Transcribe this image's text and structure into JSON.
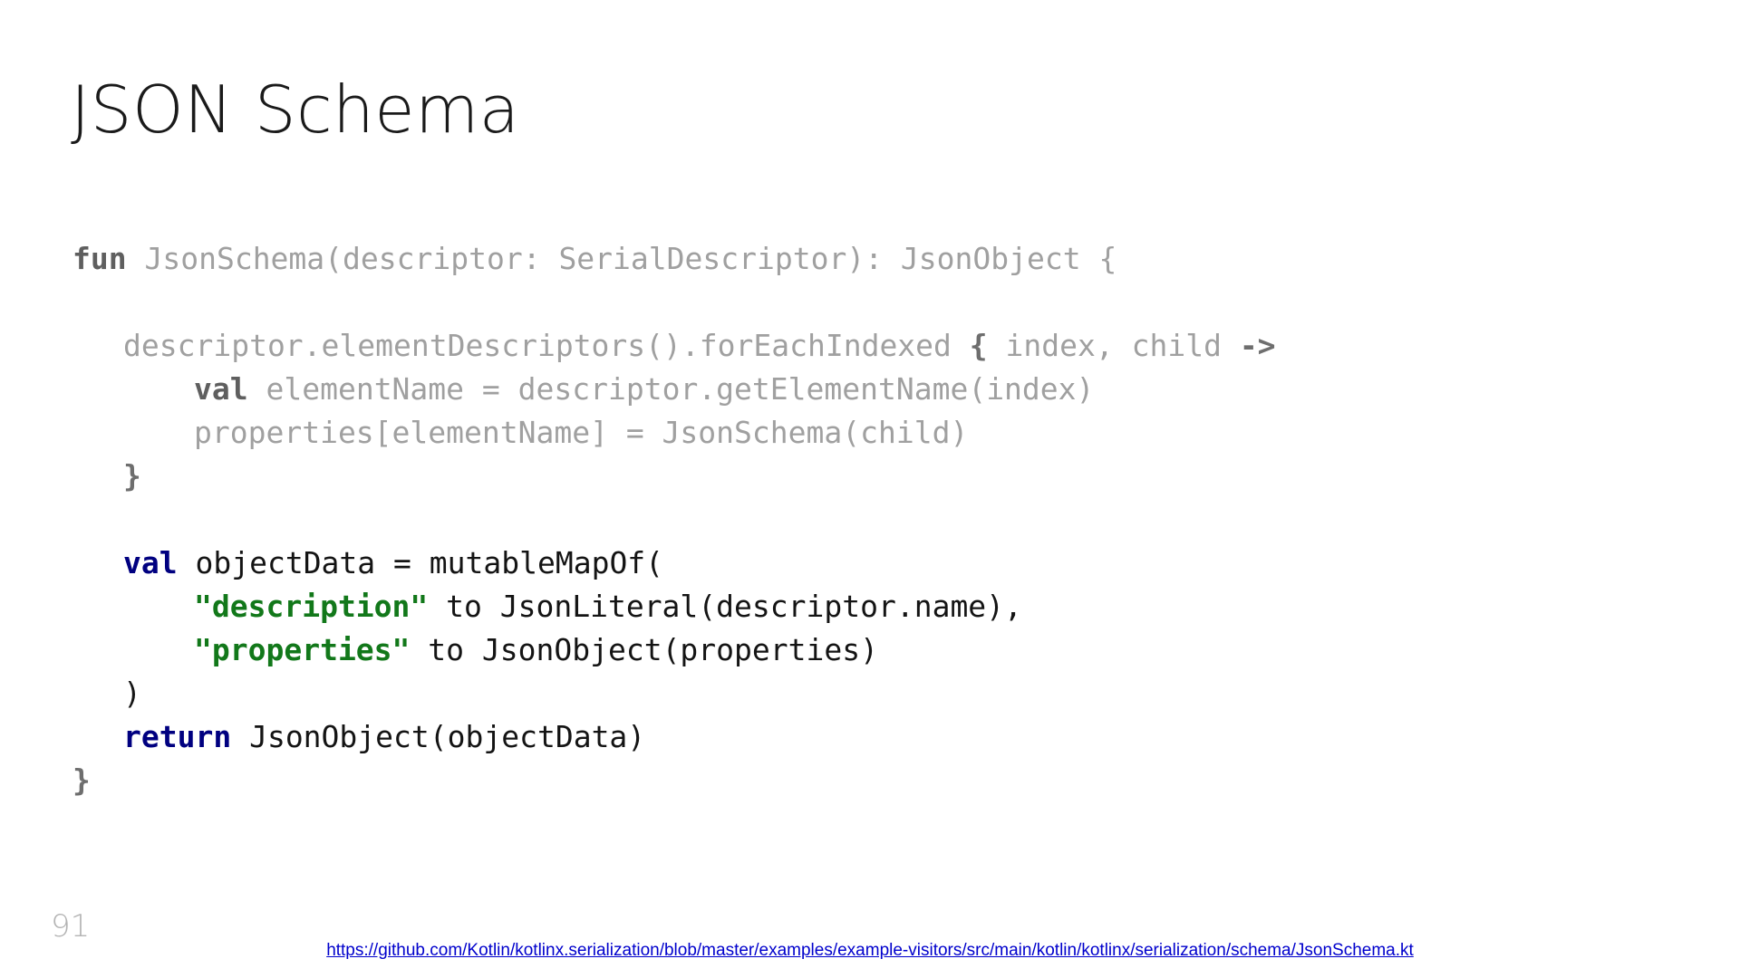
{
  "slide": {
    "title": "JSON Schema",
    "page_number": "91",
    "background_color": "#ffffff"
  },
  "colors": {
    "title_text": "#1a1a1a",
    "code_dim": "#a0a0a0",
    "code_keyword_dim": "#5f5f5f",
    "code_black": "#141414",
    "code_keyword_navy": "#000080",
    "code_string_green": "#12781a",
    "link_blue": "#0000cc",
    "page_number_gray": "#b3b3b3"
  },
  "code": {
    "language": "kotlin",
    "lines": [
      {
        "indent": 0,
        "tokens": [
          {
            "text": "fun ",
            "style": "keyword-dim"
          },
          {
            "text": "JsonSchema(descriptor: SerialDescriptor): JsonObject {",
            "style": "dim"
          }
        ]
      },
      {
        "indent": 0,
        "tokens": []
      },
      {
        "indent": 1,
        "tokens": [
          {
            "text": "descriptor.elementDescriptors().forEachIndexed ",
            "style": "dim"
          },
          {
            "text": "{",
            "style": "brace-dim"
          },
          {
            "text": " index, child ",
            "style": "dim"
          },
          {
            "text": "->",
            "style": "brace-dim"
          }
        ]
      },
      {
        "indent": 2,
        "tokens": [
          {
            "text": "val ",
            "style": "keyword-dim"
          },
          {
            "text": "elementName = descriptor.getElementName(index)",
            "style": "dim"
          }
        ]
      },
      {
        "indent": 2,
        "tokens": [
          {
            "text": "properties[elementName] = JsonSchema(child)",
            "style": "dim"
          }
        ]
      },
      {
        "indent": 1,
        "tokens": [
          {
            "text": "}",
            "style": "brace-dim"
          }
        ]
      },
      {
        "indent": 0,
        "tokens": []
      },
      {
        "indent": 1,
        "tokens": [
          {
            "text": "val ",
            "style": "navy"
          },
          {
            "text": "objectData = mutableMapOf(",
            "style": "black"
          }
        ]
      },
      {
        "indent": 2,
        "tokens": [
          {
            "text": "\"description\"",
            "style": "green"
          },
          {
            "text": " to JsonLiteral(descriptor.name),",
            "style": "black"
          }
        ]
      },
      {
        "indent": 2,
        "tokens": [
          {
            "text": "\"properties\"",
            "style": "green"
          },
          {
            "text": " to JsonObject(properties)",
            "style": "black"
          }
        ]
      },
      {
        "indent": 1,
        "tokens": [
          {
            "text": ")",
            "style": "black"
          }
        ]
      },
      {
        "indent": 1,
        "tokens": [
          {
            "text": "return ",
            "style": "navy"
          },
          {
            "text": "JsonObject(objectData)",
            "style": "black"
          }
        ]
      },
      {
        "indent": 0,
        "tokens": [
          {
            "text": "}",
            "style": "brace-dim"
          }
        ]
      }
    ],
    "plain_text": "fun JsonSchema(descriptor: SerialDescriptor): JsonObject {\n\n    descriptor.elementDescriptors().forEachIndexed { index, child ->\n        val elementName = descriptor.getElementName(index)\n        properties[elementName] = JsonSchema(child)\n    }\n\n    val objectData = mutableMapOf(\n        \"description\" to JsonLiteral(descriptor.name),\n        \"properties\" to JsonObject(properties)\n    )\n    return JsonObject(objectData)\n}"
  },
  "footer": {
    "source_url": "https://github.com/Kotlin/kotlinx.serialization/blob/master/examples/example-visitors/src/main/kotlin/kotlinx/serialization/schema/JsonSchema.kt"
  }
}
